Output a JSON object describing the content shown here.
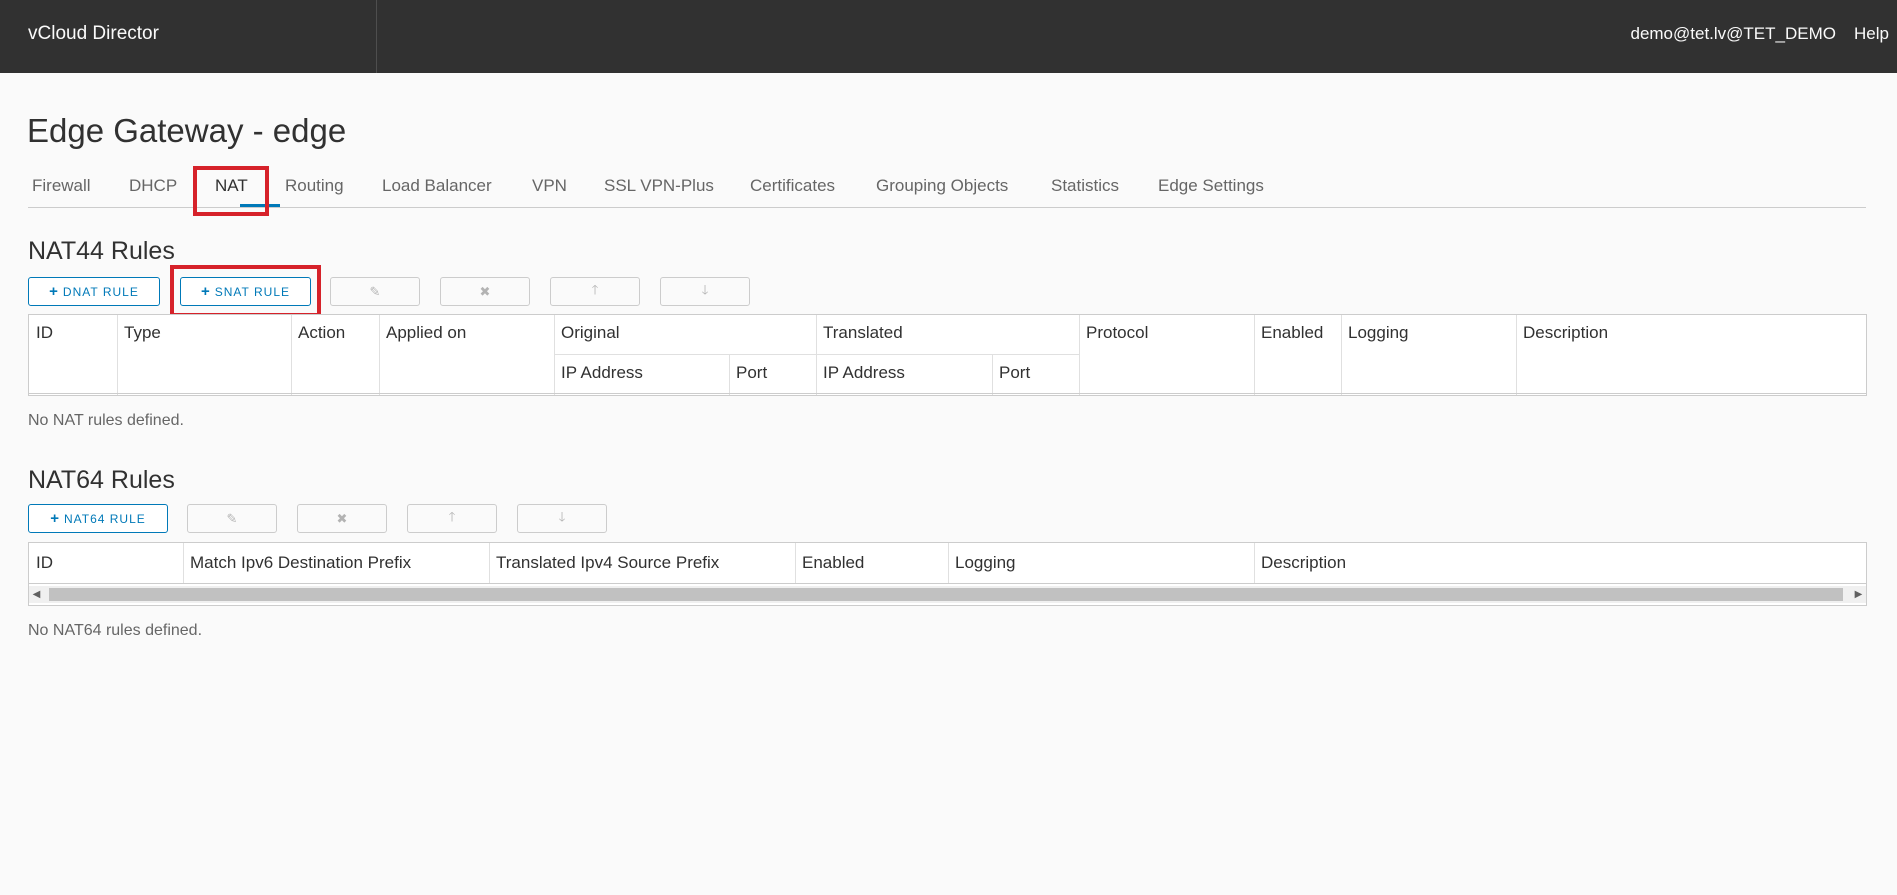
{
  "header": {
    "app_title": "vCloud Director",
    "user": "demo@tet.lv@TET_DEMO",
    "help": "Help"
  },
  "page": {
    "title": "Edge Gateway - edge"
  },
  "tabs": [
    {
      "label": "Firewall"
    },
    {
      "label": "DHCP"
    },
    {
      "label": "NAT",
      "active": true
    },
    {
      "label": "Routing"
    },
    {
      "label": "Load Balancer"
    },
    {
      "label": "VPN"
    },
    {
      "label": "SSL VPN-Plus"
    },
    {
      "label": "Certificates"
    },
    {
      "label": "Grouping Objects"
    },
    {
      "label": "Statistics"
    },
    {
      "label": "Edge Settings"
    }
  ],
  "nat44": {
    "title": "NAT44 Rules",
    "dnat_button": "DNAT RULE",
    "snat_button": "SNAT RULE",
    "columns": {
      "id": "ID",
      "type": "Type",
      "action": "Action",
      "applied_on": "Applied on",
      "original": "Original",
      "translated": "Translated",
      "ip_address": "IP Address",
      "port": "Port",
      "protocol": "Protocol",
      "enabled": "Enabled",
      "logging": "Logging",
      "description": "Description"
    },
    "empty_message": "No NAT rules defined."
  },
  "nat64": {
    "title": "NAT64 Rules",
    "add_button": "NAT64 RULE",
    "columns": {
      "id": "ID",
      "match_prefix": "Match Ipv6 Destination Prefix",
      "translated_prefix": "Translated Ipv4 Source Prefix",
      "enabled": "Enabled",
      "logging": "Logging",
      "description": "Description"
    },
    "empty_message": "No NAT64 rules defined."
  },
  "icons": {
    "add": "plus-icon",
    "edit": "edit-icon",
    "delete": "close-icon",
    "move_up": "arrow-up-icon",
    "move_down": "arrow-down-icon"
  },
  "colors": {
    "header_bg": "#313131",
    "accent": "#0079b8",
    "highlight": "#d6222a"
  }
}
